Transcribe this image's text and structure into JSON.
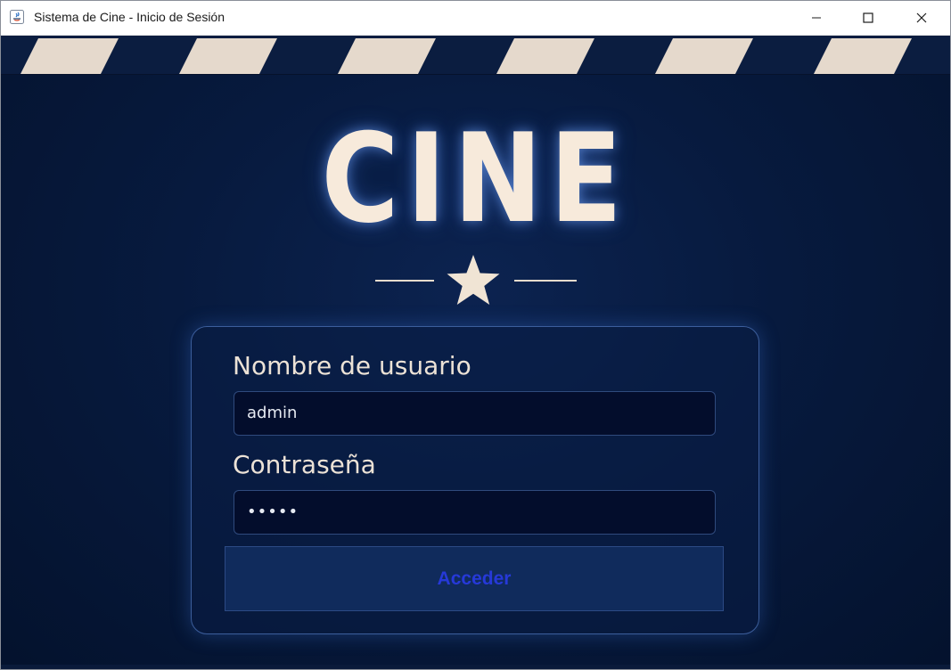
{
  "window": {
    "title": "Sistema de Cine - Inicio de Sesión"
  },
  "header": {
    "logo_text": "CINE",
    "ornament_icon": "star-icon"
  },
  "login_form": {
    "username_label": "Nombre de usuario",
    "username_value": "admin",
    "password_label": "Contraseña",
    "password_value": "•••••",
    "submit_label": "Acceder"
  },
  "colors": {
    "background": "#071a3e",
    "logo": "#f7eadb",
    "panel_border": "#3c5e9c",
    "input_background": "#030d2c",
    "button_background": "#102b5c",
    "button_text": "#2639d8",
    "clapper_stripe": "#e5d9cc"
  },
  "icons": [
    "java-app-icon",
    "minimize-icon",
    "maximize-icon",
    "close-icon",
    "star-icon"
  ]
}
